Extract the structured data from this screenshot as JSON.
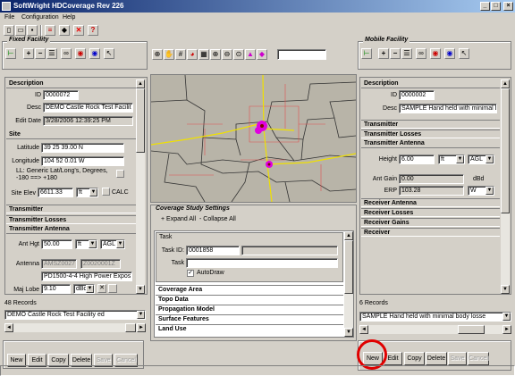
{
  "window": {
    "title": "SoftWright HDCoverage Rev 226"
  },
  "menu": [
    "File",
    "Configuration",
    "Help"
  ],
  "fixed_facility": {
    "group_label": "Fixed Facility",
    "description": {
      "header": "Description",
      "id_label": "ID",
      "id_value": "0000072",
      "desc_label": "Desc",
      "desc_value": "DEMO Castle Rock Test Facilit",
      "edit_date_label": "Edit Date",
      "edit_date_value": "3/28/2006 12:39:25 PM"
    },
    "site": {
      "header": "Site",
      "lat_label": "Latitude",
      "lat_value": "39 25 39.00 N",
      "lon_label": "Longitude",
      "lon_value": "104 52 0.01 W",
      "ll_note": "LL: Generic Lat/Long's, Degrees, -180 ==> +180",
      "elev_label": "Site Elev",
      "elev_value": "6611.33",
      "elev_unit": "ft",
      "calc_label": "CALC"
    },
    "transmitter_header": "Transmitter",
    "transmitter_losses_header": "Transmitter Losses",
    "transmitter_antenna": {
      "header": "Transmitter Antenna",
      "ant_hgt_label": "Ant Hgt",
      "ant_hgt_value": "50.00",
      "ant_hgt_unit": "ft",
      "ant_hgt_ref": "AGL",
      "antenna_label": "Antenna",
      "antenna_code1": "AMSZ0027",
      "antenna_code2": "Z0020001Z",
      "antenna_desc": "PD1500-4-4 High Power Expos",
      "maj_lobe_label": "Maj Lobe",
      "maj_lobe_value": "9.10",
      "maj_lobe_unit": "dBd"
    },
    "records": "48 Records",
    "selected_record": "DEMO Castle Rock Test Facility ed",
    "buttons": [
      "New",
      "Edit",
      "Copy",
      "Delete",
      "Save",
      "Cancel"
    ]
  },
  "map_area": {
    "hint": "Coverage Study Settings",
    "expand_all": "+ Expand All",
    "collapse_all": "- Collapse All"
  },
  "coverage_study": {
    "task_group": "Task",
    "task_id_label": "Task ID:",
    "task_id_value": "0001858",
    "task_label": "Task",
    "autodraw_label": "AutoDraw",
    "sections": [
      "Coverage Area",
      "Topo Data",
      "Propagation Model",
      "Surface Features",
      "Land Use"
    ]
  },
  "mobile_facility": {
    "group_label": "Mobile Facility",
    "description": {
      "header": "Description",
      "id_label": "ID",
      "id_value": "0000002",
      "desc_label": "Desc",
      "desc_value": "SAMPLE Hand held with minimal boc"
    },
    "transmitter_header": "Transmitter",
    "transmitter_losses_header": "Transmitter Losses",
    "transmitter_antenna": {
      "header": "Transmitter Antenna",
      "height_label": "Height",
      "height_value": "6.00",
      "height_unit": "ft",
      "height_ref": "AGL",
      "ant_gain_label": "Ant Gain",
      "ant_gain_value": "0.00",
      "ant_gain_unit": "dBd",
      "erp_label": "ERP",
      "erp_value": "103.28",
      "erp_unit": "W"
    },
    "receiver_antenna_header": "Receiver Antenna",
    "receiver_losses_header": "Receiver Losses",
    "receiver_gains_header": "Receiver Gains",
    "receiver_header": "Receiver",
    "records": "6 Records",
    "selected_record": "SAMPLE Hand held with minimal body losse",
    "buttons": [
      "New",
      "Edit",
      "Copy",
      "Delete",
      "Save",
      "Cancel"
    ]
  },
  "colors": {
    "titlebar_start": "#0a246a",
    "highlight_circle": "#e00000",
    "map_bg": "#b8b4a8"
  }
}
